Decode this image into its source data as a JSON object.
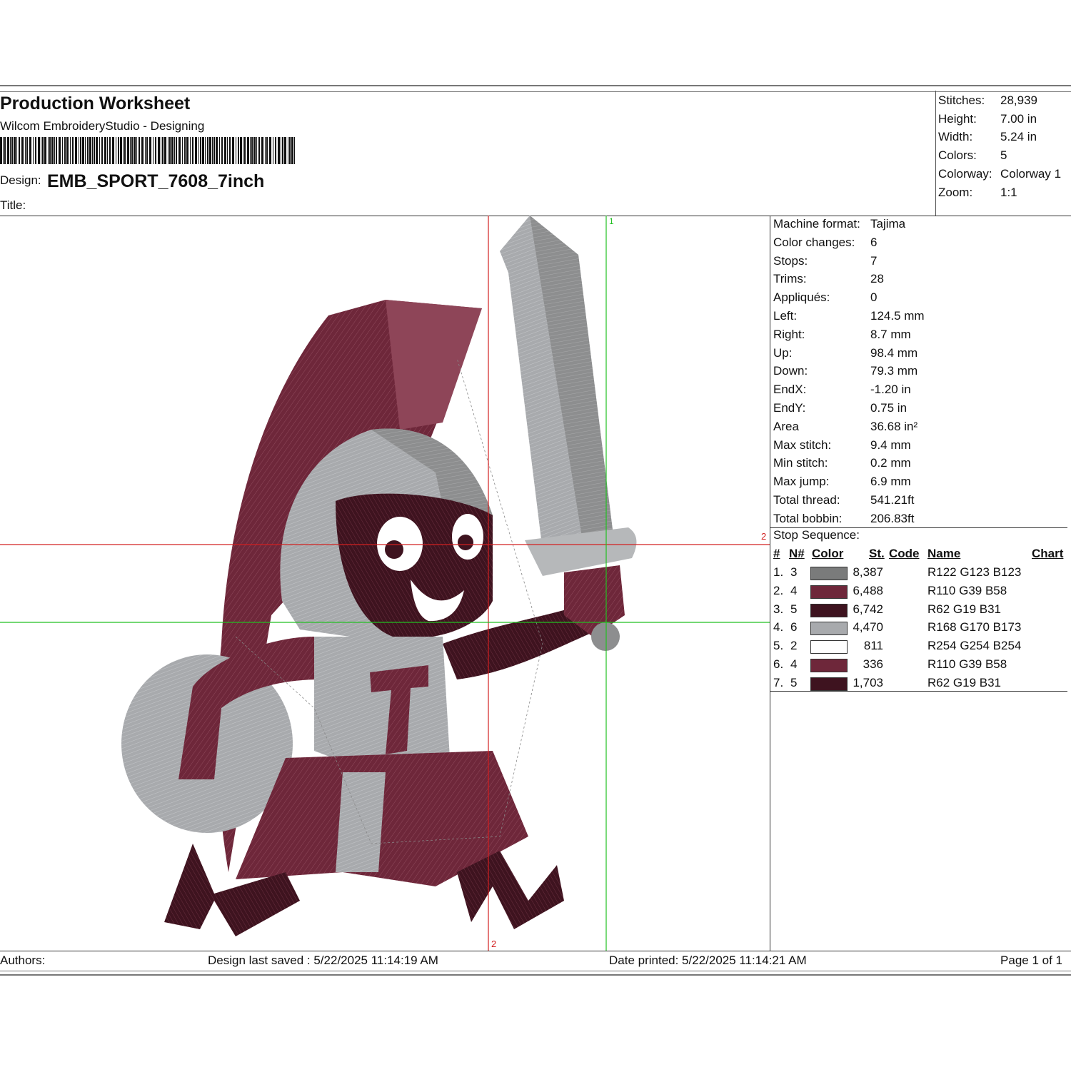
{
  "header": {
    "title": "Production Worksheet",
    "subtitle": "Wilcom EmbroideryStudio - Designing",
    "design_label": "Design:",
    "design_name": "EMB_SPORT_7608_7inch",
    "title_label": "Title:"
  },
  "summary": [
    {
      "label": "Stitches:",
      "value": "28,939"
    },
    {
      "label": "Height:",
      "value": "7.00 in"
    },
    {
      "label": "Width:",
      "value": "5.24 in"
    },
    {
      "label": "Colors:",
      "value": "5"
    },
    {
      "label": "Colorway:",
      "value": "Colorway 1"
    },
    {
      "label": "Zoom:",
      "value": "1:1"
    }
  ],
  "machine_info": [
    {
      "label": "Machine format:",
      "value": "Tajima"
    },
    {
      "label": "Color changes:",
      "value": "6"
    },
    {
      "label": "Stops:",
      "value": "7"
    },
    {
      "label": "Trims:",
      "value": "28"
    },
    {
      "label": "Appliqués:",
      "value": "0"
    },
    {
      "label": "Left:",
      "value": "124.5 mm"
    },
    {
      "label": "Right:",
      "value": "8.7 mm"
    },
    {
      "label": "Up:",
      "value": "98.4 mm"
    },
    {
      "label": "Down:",
      "value": "79.3 mm"
    },
    {
      "label": "EndX:",
      "value": "-1.20 in"
    },
    {
      "label": "EndY:",
      "value": "0.75 in"
    },
    {
      "label": "Area",
      "value": " 36.68 in²"
    },
    {
      "label": "Max stitch:",
      "value": "9.4 mm"
    },
    {
      "label": "Min stitch:",
      "value": "0.2 mm"
    },
    {
      "label": "Max jump:",
      "value": "6.9 mm"
    },
    {
      "label": "Total thread:",
      "value": "541.21ft"
    },
    {
      "label": "Total bobbin:",
      "value": "206.83ft"
    }
  ],
  "stop_sequence": {
    "title": "Stop Sequence:",
    "headers": {
      "num": "#",
      "needle": "N#",
      "color": "Color",
      "stitches": "St.",
      "code": "Code",
      "name": "Name",
      "chart": "Chart"
    },
    "rows": [
      {
        "num": "1.",
        "needle": "3",
        "color": "#7A7B7B",
        "stitches": "8,387",
        "name": "R122 G123 B123"
      },
      {
        "num": "2.",
        "needle": "4",
        "color": "#6E273A",
        "stitches": "6,488",
        "name": "R110 G39 B58"
      },
      {
        "num": "3.",
        "needle": "5",
        "color": "#3E131F",
        "stitches": "6,742",
        "name": "R62 G19 B31"
      },
      {
        "num": "4.",
        "needle": "6",
        "color": "#A8AAAD",
        "stitches": "4,470",
        "name": "R168 G170 B173"
      },
      {
        "num": "5.",
        "needle": "2",
        "color": "#FEFEFE",
        "stitches": "811",
        "name": "R254 G254 B254"
      },
      {
        "num": "6.",
        "needle": "4",
        "color": "#6E273A",
        "stitches": "336",
        "name": "R110 G39 B58"
      },
      {
        "num": "7.",
        "needle": "5",
        "color": "#3E131F",
        "stitches": "1,703",
        "name": "R62 G19 B31"
      }
    ]
  },
  "guides": {
    "green_top": "1",
    "red_right": "2",
    "red_bottom": "2"
  },
  "footer": {
    "authors": "Authors:",
    "saved": "Design last saved : 5/22/2025 11:14:19 AM",
    "printed": "Date printed: 5/22/2025 11:14:21 AM",
    "page": "Page 1 of 1"
  },
  "palette": {
    "maroon": "#6E273A",
    "dark_maroon": "#3E131F",
    "gray": "#A8AAAD",
    "dark_gray": "#7A7B7B",
    "red_guide": "#D22020",
    "green_guide": "#22C022"
  }
}
